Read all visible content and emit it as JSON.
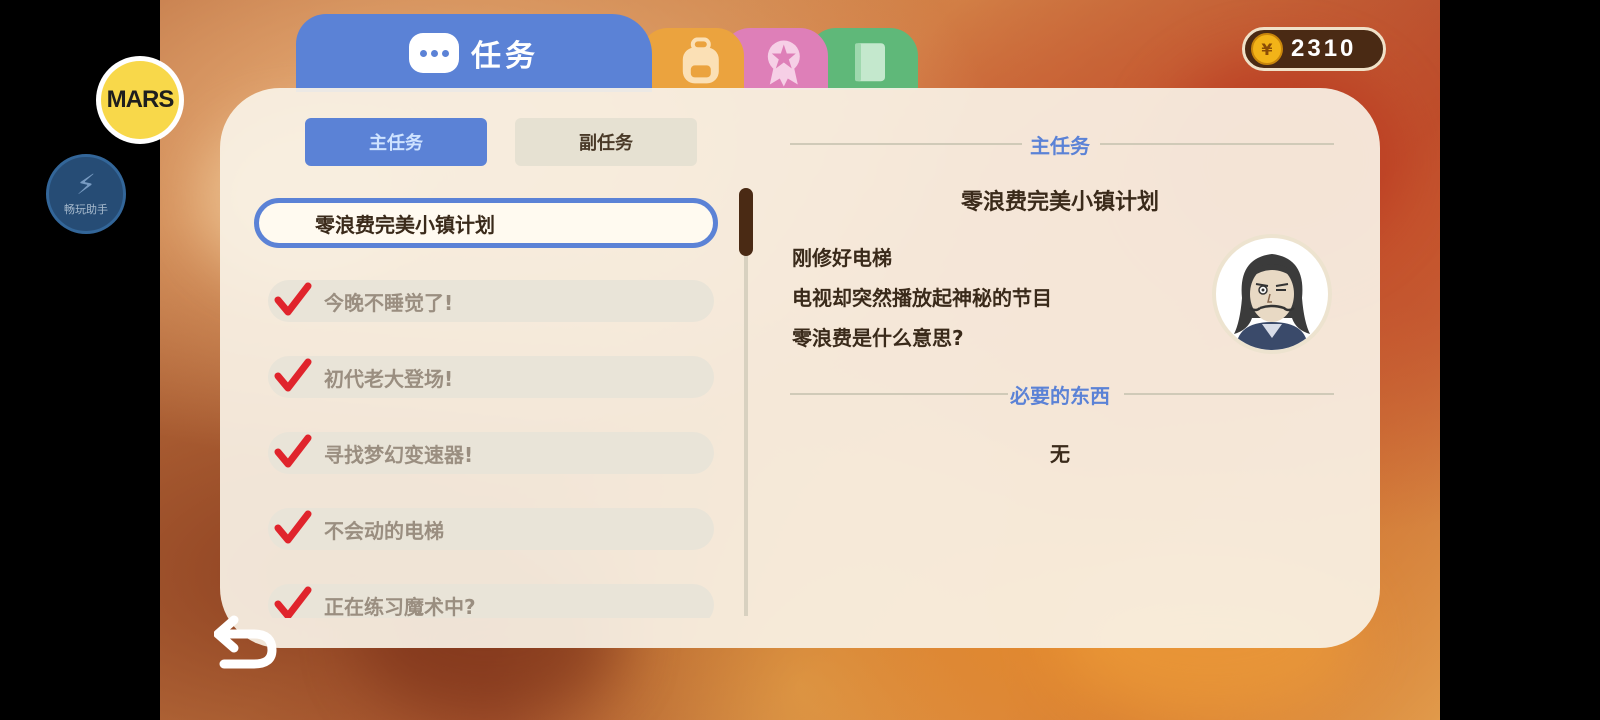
{
  "header": {
    "active_tab_label": "任务",
    "tabs": [
      {
        "name": "quest",
        "icon": "chat-bubble-icon",
        "color": "#5b82d6"
      },
      {
        "name": "bag",
        "icon": "backpack-icon",
        "color": "#eba33e"
      },
      {
        "name": "award",
        "icon": "medal-icon",
        "color": "#de7fb8"
      },
      {
        "name": "book",
        "icon": "book-icon",
        "color": "#5fb879"
      }
    ],
    "coins": "2310"
  },
  "overlay": {
    "mars_label": "MARS",
    "helper_label": "畅玩助手"
  },
  "subtabs": {
    "main": "主任务",
    "side": "副任务"
  },
  "quest_list": {
    "selected": "零浪费完美小镇计划",
    "completed": [
      "今晚不睡觉了!",
      "初代老大登场!",
      "寻找梦幻变速器!",
      "不会动的电梯",
      "正在练习魔术中?"
    ]
  },
  "detail": {
    "section_title": "主任务",
    "quest_name": "零浪费完美小镇计划",
    "description": [
      "刚修好电梯",
      "电视却突然播放起神秘的节目",
      "零浪费是什么意思?"
    ],
    "items_title": "必要的东西",
    "items_value": "无"
  },
  "colors": {
    "accent_blue": "#5b82d6",
    "check_red": "#e0242c",
    "dark_brown": "#4a2a14"
  }
}
